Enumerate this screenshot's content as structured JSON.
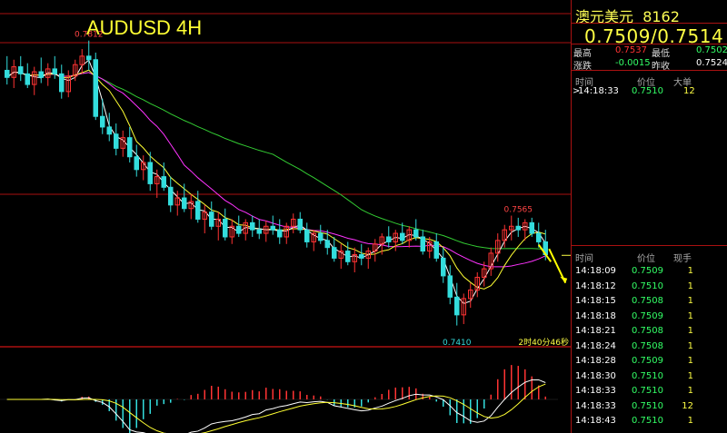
{
  "chart_data": {
    "type": "candlestick",
    "title": "AUDUSD 4H",
    "annotations": {
      "high": "0.7812",
      "low": "0.7410",
      "recent_high": "0.7565",
      "countdown": "2时40分46秒"
    },
    "ylim": [
      0.738,
      0.785
    ],
    "candles": [
      [
        0.777,
        0.779,
        0.775,
        0.776
      ],
      [
        0.776,
        0.7785,
        0.7745,
        0.7775
      ],
      [
        0.7775,
        0.779,
        0.7755,
        0.7765
      ],
      [
        0.7765,
        0.778,
        0.7745,
        0.775
      ],
      [
        0.775,
        0.7775,
        0.7735,
        0.7768
      ],
      [
        0.7768,
        0.7788,
        0.7752,
        0.776
      ],
      [
        0.776,
        0.778,
        0.7748,
        0.7772
      ],
      [
        0.7772,
        0.779,
        0.7758,
        0.7765
      ],
      [
        0.7765,
        0.7778,
        0.773,
        0.774
      ],
      [
        0.774,
        0.777,
        0.7732,
        0.7762
      ],
      [
        0.7762,
        0.7785,
        0.7755,
        0.7778
      ],
      [
        0.7778,
        0.78,
        0.7765,
        0.779
      ],
      [
        0.779,
        0.7812,
        0.777,
        0.7785
      ],
      [
        0.7785,
        0.7795,
        0.77,
        0.7705
      ],
      [
        0.7705,
        0.773,
        0.768,
        0.769
      ],
      [
        0.769,
        0.771,
        0.767,
        0.768
      ],
      [
        0.768,
        0.7695,
        0.765,
        0.766
      ],
      [
        0.766,
        0.7685,
        0.7648,
        0.7675
      ],
      [
        0.7675,
        0.769,
        0.764,
        0.7648
      ],
      [
        0.7648,
        0.7665,
        0.762,
        0.763
      ],
      [
        0.763,
        0.765,
        0.7615,
        0.764
      ],
      [
        0.764,
        0.7655,
        0.76,
        0.761
      ],
      [
        0.761,
        0.763,
        0.759,
        0.762
      ],
      [
        0.762,
        0.764,
        0.76,
        0.7605
      ],
      [
        0.7605,
        0.762,
        0.757,
        0.758
      ],
      [
        0.758,
        0.76,
        0.7565,
        0.759
      ],
      [
        0.759,
        0.761,
        0.757,
        0.7575
      ],
      [
        0.7575,
        0.7595,
        0.756,
        0.7585
      ],
      [
        0.7585,
        0.76,
        0.7555,
        0.756
      ],
      [
        0.756,
        0.758,
        0.754,
        0.757
      ],
      [
        0.757,
        0.7585,
        0.7545,
        0.755
      ],
      [
        0.755,
        0.757,
        0.753,
        0.756
      ],
      [
        0.756,
        0.7575,
        0.753,
        0.7535
      ],
      [
        0.7535,
        0.756,
        0.7525,
        0.755
      ],
      [
        0.755,
        0.7565,
        0.7535,
        0.754
      ],
      [
        0.754,
        0.756,
        0.753,
        0.7555
      ],
      [
        0.7555,
        0.7565,
        0.7535,
        0.7545
      ],
      [
        0.7545,
        0.756,
        0.7532,
        0.754
      ],
      [
        0.754,
        0.7558,
        0.7528,
        0.755
      ],
      [
        0.755,
        0.7565,
        0.7538,
        0.7545
      ],
      [
        0.7545,
        0.756,
        0.7525,
        0.7535
      ],
      [
        0.7535,
        0.7555,
        0.7525,
        0.755
      ],
      [
        0.755,
        0.7568,
        0.754,
        0.756
      ],
      [
        0.756,
        0.757,
        0.754,
        0.7545
      ],
      [
        0.7545,
        0.7555,
        0.752,
        0.7528
      ],
      [
        0.7528,
        0.7545,
        0.7515,
        0.754
      ],
      [
        0.754,
        0.7552,
        0.7525,
        0.753
      ],
      [
        0.753,
        0.7545,
        0.751,
        0.752
      ],
      [
        0.752,
        0.7535,
        0.75,
        0.7505
      ],
      [
        0.7505,
        0.7525,
        0.749,
        0.7515
      ],
      [
        0.7515,
        0.7528,
        0.7495,
        0.75
      ],
      [
        0.75,
        0.752,
        0.7485,
        0.751
      ],
      [
        0.751,
        0.7525,
        0.7495,
        0.7505
      ],
      [
        0.7505,
        0.752,
        0.749,
        0.7515
      ],
      [
        0.7515,
        0.7532,
        0.75,
        0.7525
      ],
      [
        0.7525,
        0.754,
        0.751,
        0.7535
      ],
      [
        0.7535,
        0.755,
        0.752,
        0.7528
      ],
      [
        0.7528,
        0.7545,
        0.7515,
        0.754
      ],
      [
        0.754,
        0.7555,
        0.7525,
        0.753
      ],
      [
        0.753,
        0.755,
        0.752,
        0.7545
      ],
      [
        0.7545,
        0.756,
        0.753,
        0.7535
      ],
      [
        0.7535,
        0.7545,
        0.751,
        0.7515
      ],
      [
        0.7515,
        0.7535,
        0.7505,
        0.7528
      ],
      [
        0.7528,
        0.754,
        0.75,
        0.7505
      ],
      [
        0.7505,
        0.752,
        0.747,
        0.748
      ],
      [
        0.748,
        0.7495,
        0.744,
        0.745
      ],
      [
        0.745,
        0.747,
        0.741,
        0.7425
      ],
      [
        0.7425,
        0.7455,
        0.7412,
        0.7448
      ],
      [
        0.7448,
        0.747,
        0.7435,
        0.746
      ],
      [
        0.746,
        0.7485,
        0.745,
        0.7478
      ],
      [
        0.7478,
        0.75,
        0.7465,
        0.749
      ],
      [
        0.749,
        0.752,
        0.748,
        0.7512
      ],
      [
        0.7512,
        0.754,
        0.75,
        0.753
      ],
      [
        0.753,
        0.7552,
        0.752,
        0.7545
      ],
      [
        0.7545,
        0.7565,
        0.753,
        0.755
      ],
      [
        0.755,
        0.7562,
        0.7535,
        0.7545
      ],
      [
        0.7545,
        0.756,
        0.753,
        0.7555
      ],
      [
        0.7555,
        0.7562,
        0.7535,
        0.754
      ],
      [
        0.754,
        0.7555,
        0.752,
        0.7528
      ],
      [
        0.7528,
        0.7545,
        0.7502,
        0.751
      ]
    ],
    "forecast_arrows": [
      [
        0.7524,
        0.75
      ],
      [
        0.7518,
        0.747
      ]
    ],
    "last_price_marker": 0.7509
  },
  "colors": {
    "up": "#ff3333",
    "down": "#33dddd",
    "ma_white": "#ffffff",
    "ma_yellow": "#ffff33",
    "ma_magenta": "#ff33ff",
    "ma_green": "#33cc33",
    "grid": "#aa1111",
    "arrow": "#ffff00"
  },
  "panel": {
    "symbol": "澳元美元",
    "code": "8162",
    "quote": "0.7509/0.7514",
    "stats": [
      {
        "l1": "最高",
        "v1": "0.7537",
        "c1": "red",
        "l2": "最低",
        "v2": "0.7502",
        "c2": "green"
      },
      {
        "l1": "涨跌",
        "v1": "-0.0015",
        "c1": "green",
        "l2": "昨收",
        "v2": "0.7524",
        "c2": "white"
      }
    ],
    "trade_header": {
      "time": "时间",
      "price": "价位",
      "vol": "大单"
    },
    "big_trades": [
      {
        "time": "14:18:33",
        "price": "0.7510",
        "vol": "12"
      }
    ],
    "tick_header": {
      "time": "时间",
      "price": "价位",
      "vol": "现手"
    },
    "ticks": [
      {
        "time": "14:18:09",
        "price": "0.7509",
        "vol": "1"
      },
      {
        "time": "14:18:12",
        "price": "0.7510",
        "vol": "1"
      },
      {
        "time": "14:18:15",
        "price": "0.7508",
        "vol": "1"
      },
      {
        "time": "14:18:18",
        "price": "0.7509",
        "vol": "1"
      },
      {
        "time": "14:18:21",
        "price": "0.7508",
        "vol": "1"
      },
      {
        "time": "14:18:24",
        "price": "0.7508",
        "vol": "1"
      },
      {
        "time": "14:18:28",
        "price": "0.7509",
        "vol": "1"
      },
      {
        "time": "14:18:30",
        "price": "0.7510",
        "vol": "1"
      },
      {
        "time": "14:18:33",
        "price": "0.7510",
        "vol": "1"
      },
      {
        "time": "14:18:33",
        "price": "0.7510",
        "vol": "12"
      },
      {
        "time": "14:18:43",
        "price": "0.7510",
        "vol": "1"
      }
    ]
  }
}
